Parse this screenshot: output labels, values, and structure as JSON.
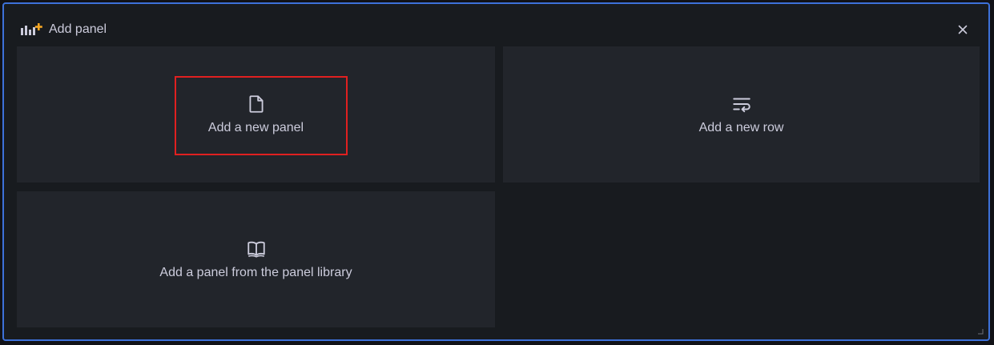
{
  "dialog": {
    "title": "Add panel",
    "header_icon": "add-panel-icon",
    "close_icon": "close-icon",
    "accent_border_color": "#3d71d9"
  },
  "options": [
    {
      "label": "Add a new panel",
      "icon": "file-icon",
      "highlighted": true
    },
    {
      "label": "Add a new row",
      "icon": "row-wrap-icon"
    },
    {
      "label": "Add a panel from the panel library",
      "icon": "book-icon"
    }
  ],
  "colors": {
    "background": "#181b1f",
    "tile": "#22252b",
    "text": "#ccccdc",
    "highlight": "#e02020",
    "plus_orange": "#f5a623"
  }
}
